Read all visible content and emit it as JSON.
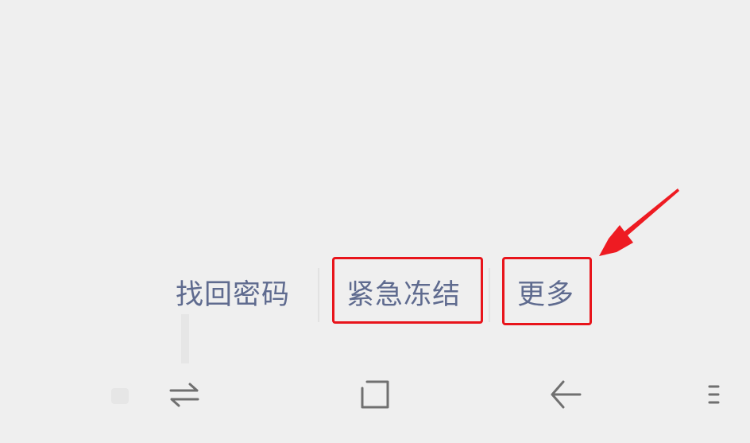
{
  "login_links": {
    "find_password": "找回密码",
    "emergency_freeze": "紧急冻结",
    "more": "更多"
  },
  "annotations": {
    "highlight_color": "#e8141b",
    "arrow_target": "more-link"
  },
  "nav_bar": {
    "icons": [
      "switch-apps-icon",
      "home-square-icon",
      "back-arrow-icon",
      "menu-icon"
    ]
  },
  "colors": {
    "background": "#efefef",
    "link_text": "#5f6b8f",
    "nav_icon": "#707070"
  }
}
